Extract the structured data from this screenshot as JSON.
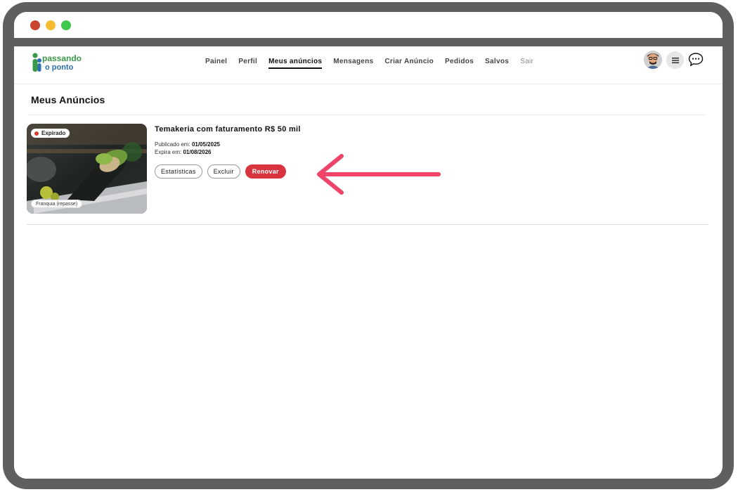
{
  "window": {
    "traffic_lights": [
      "close",
      "minimize",
      "zoom"
    ]
  },
  "header": {
    "logo_text_top": "passando",
    "logo_text_bottom": "o ponto",
    "nav": [
      {
        "label": "Painel"
      },
      {
        "label": "Perfil"
      },
      {
        "label": "Meus anúncios",
        "active": true
      },
      {
        "label": "Mensagens"
      },
      {
        "label": "Criar Anúncio"
      },
      {
        "label": "Pedidos"
      },
      {
        "label": "Salvos"
      },
      {
        "label": "Sair",
        "muted": true
      }
    ],
    "icons": {
      "menu": "hamburger-icon",
      "chat": "chat-bubble-icon"
    }
  },
  "main": {
    "title": "Meus Anúncios",
    "listing": {
      "status_badge": "Expirado",
      "category_badge": "Franquia (repasse)",
      "title": "Temakeria com faturamento R$ 50 mil",
      "published_label": "Publicado em:",
      "published_date": "01/05/2025",
      "expires_label": "Expira em:",
      "expires_date": "01/08/2026",
      "actions": {
        "stats": "Estatísticas",
        "delete": "Excluir",
        "renew": "Renovar"
      }
    }
  },
  "colors": {
    "accent": "#d8343f",
    "arrow": "#f0436a",
    "status_red": "#e0392f",
    "logo_green": "#3a9a4a",
    "logo_blue": "#2d6fb0"
  }
}
